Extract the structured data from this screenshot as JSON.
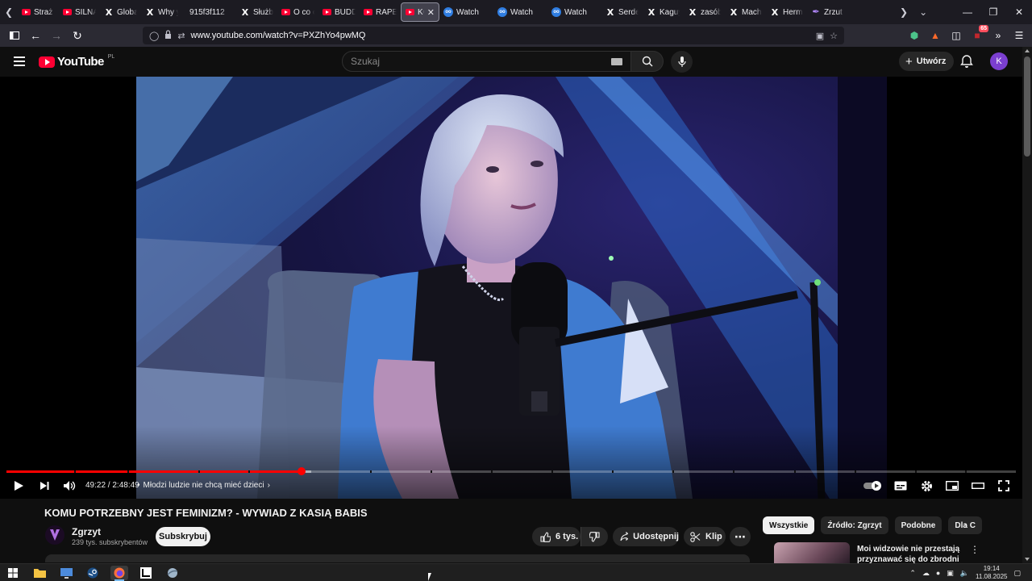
{
  "browser": {
    "tabs": [
      {
        "title": "Straż",
        "favicon": "youtube-icon"
      },
      {
        "title": "SILNA",
        "favicon": "youtube-icon"
      },
      {
        "title": "Globa",
        "favicon": "x-icon"
      },
      {
        "title": "Why y",
        "favicon": "x-icon"
      },
      {
        "title": "915f3f112",
        "favicon": "none"
      },
      {
        "title": "Służb",
        "favicon": "x-icon"
      },
      {
        "title": "O co c",
        "favicon": "youtube-icon"
      },
      {
        "title": "BUDD",
        "favicon": "youtube-icon"
      },
      {
        "title": "RAPE",
        "favicon": "youtube-icon"
      },
      {
        "title": "KO",
        "favicon": "youtube-icon",
        "active": true
      },
      {
        "title": "Watch",
        "favicon": "video-icon"
      },
      {
        "title": "Watch",
        "favicon": "video-icon"
      },
      {
        "title": "Watch",
        "favicon": "video-icon"
      },
      {
        "title": "Serde",
        "favicon": "x-icon"
      },
      {
        "title": "Kaguy",
        "favicon": "x-icon"
      },
      {
        "title": "zasób",
        "favicon": "x-icon"
      },
      {
        "title": "Mach",
        "favicon": "x-icon"
      },
      {
        "title": "Herm",
        "favicon": "x-icon"
      },
      {
        "title": "Zrzut",
        "favicon": "feather-icon"
      }
    ],
    "url_display": "www.youtube.com/watch?v=PXZhYo4pwMQ",
    "extension_badge": "65",
    "accent": "#8f8f9d"
  },
  "youtube": {
    "logo_text": "YouTube",
    "region": "PL",
    "search_placeholder": "Szukaj",
    "create_label": "Utwórz",
    "avatar_letter": "K",
    "brand_color": "#ff0033"
  },
  "player": {
    "current_time": "49:22",
    "duration": "2:48:49",
    "time_display": "49:22 / 2:48:49",
    "progress_fraction": 0.292,
    "chapter_title": "Młodzi ludzie nie chcą mieć dzieci",
    "autoplay": true
  },
  "video": {
    "title": "KOMU POTRZEBNY JEST FEMINIZM? - WYWIAD Z KASIĄ BABIS",
    "channel_name": "Zgrzyt",
    "subscribers": "239 tys. subskrybentów",
    "subscribe_label": "Subskrybuj",
    "likes": "6 tys.",
    "share_label": "Udostępnij",
    "clip_label": "Klip"
  },
  "sidebar": {
    "chips": [
      "Wszystkie",
      "Źródło: Zgrzyt",
      "Podobne",
      "Dla C"
    ],
    "active_chip": 0,
    "recommendation_title": "Moi widzowie nie przestają przyznawać się do zbrodni"
  },
  "taskbar": {
    "time": "19:14",
    "date": "11.08.2025"
  }
}
